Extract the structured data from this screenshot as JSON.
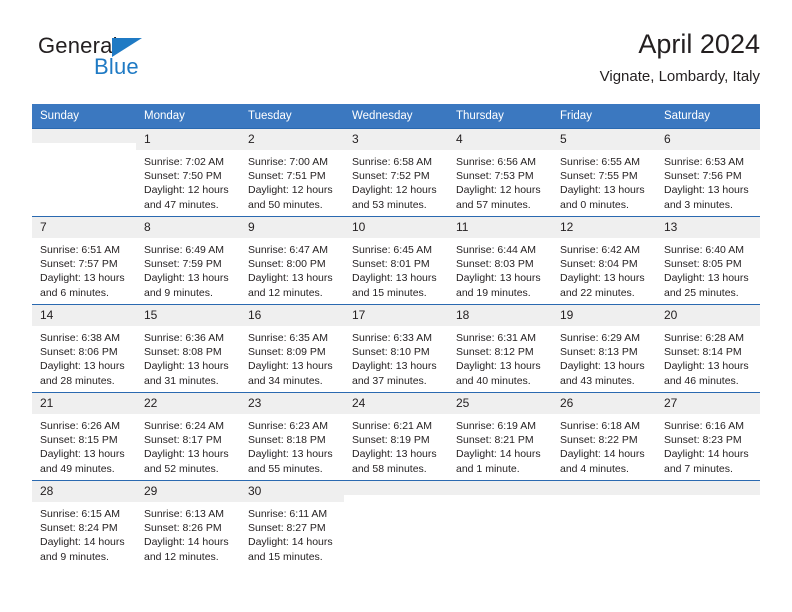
{
  "brand": {
    "name_top": "General",
    "name_bottom": "Blue",
    "triangle_color": "#1f7ac4"
  },
  "header": {
    "title": "April 2024",
    "subtitle": "Vignate, Lombardy, Italy"
  },
  "theme": {
    "header_bg": "#3b78c0",
    "row_border": "#2a69b0",
    "daynum_bg": "#efefef",
    "text": "#231f20"
  },
  "weekdays": [
    "Sunday",
    "Monday",
    "Tuesday",
    "Wednesday",
    "Thursday",
    "Friday",
    "Saturday"
  ],
  "labels": {
    "sunrise_prefix": "Sunrise:",
    "sunset_prefix": "Sunset:",
    "daylight_prefix": "Daylight:"
  },
  "weeks": [
    [
      {
        "day": "",
        "sunrise": "",
        "sunset": "",
        "daylight1": "",
        "daylight2": ""
      },
      {
        "day": "1",
        "sunrise": "Sunrise: 7:02 AM",
        "sunset": "Sunset: 7:50 PM",
        "daylight1": "Daylight: 12 hours",
        "daylight2": "and 47 minutes."
      },
      {
        "day": "2",
        "sunrise": "Sunrise: 7:00 AM",
        "sunset": "Sunset: 7:51 PM",
        "daylight1": "Daylight: 12 hours",
        "daylight2": "and 50 minutes."
      },
      {
        "day": "3",
        "sunrise": "Sunrise: 6:58 AM",
        "sunset": "Sunset: 7:52 PM",
        "daylight1": "Daylight: 12 hours",
        "daylight2": "and 53 minutes."
      },
      {
        "day": "4",
        "sunrise": "Sunrise: 6:56 AM",
        "sunset": "Sunset: 7:53 PM",
        "daylight1": "Daylight: 12 hours",
        "daylight2": "and 57 minutes."
      },
      {
        "day": "5",
        "sunrise": "Sunrise: 6:55 AM",
        "sunset": "Sunset: 7:55 PM",
        "daylight1": "Daylight: 13 hours",
        "daylight2": "and 0 minutes."
      },
      {
        "day": "6",
        "sunrise": "Sunrise: 6:53 AM",
        "sunset": "Sunset: 7:56 PM",
        "daylight1": "Daylight: 13 hours",
        "daylight2": "and 3 minutes."
      }
    ],
    [
      {
        "day": "7",
        "sunrise": "Sunrise: 6:51 AM",
        "sunset": "Sunset: 7:57 PM",
        "daylight1": "Daylight: 13 hours",
        "daylight2": "and 6 minutes."
      },
      {
        "day": "8",
        "sunrise": "Sunrise: 6:49 AM",
        "sunset": "Sunset: 7:59 PM",
        "daylight1": "Daylight: 13 hours",
        "daylight2": "and 9 minutes."
      },
      {
        "day": "9",
        "sunrise": "Sunrise: 6:47 AM",
        "sunset": "Sunset: 8:00 PM",
        "daylight1": "Daylight: 13 hours",
        "daylight2": "and 12 minutes."
      },
      {
        "day": "10",
        "sunrise": "Sunrise: 6:45 AM",
        "sunset": "Sunset: 8:01 PM",
        "daylight1": "Daylight: 13 hours",
        "daylight2": "and 15 minutes."
      },
      {
        "day": "11",
        "sunrise": "Sunrise: 6:44 AM",
        "sunset": "Sunset: 8:03 PM",
        "daylight1": "Daylight: 13 hours",
        "daylight2": "and 19 minutes."
      },
      {
        "day": "12",
        "sunrise": "Sunrise: 6:42 AM",
        "sunset": "Sunset: 8:04 PM",
        "daylight1": "Daylight: 13 hours",
        "daylight2": "and 22 minutes."
      },
      {
        "day": "13",
        "sunrise": "Sunrise: 6:40 AM",
        "sunset": "Sunset: 8:05 PM",
        "daylight1": "Daylight: 13 hours",
        "daylight2": "and 25 minutes."
      }
    ],
    [
      {
        "day": "14",
        "sunrise": "Sunrise: 6:38 AM",
        "sunset": "Sunset: 8:06 PM",
        "daylight1": "Daylight: 13 hours",
        "daylight2": "and 28 minutes."
      },
      {
        "day": "15",
        "sunrise": "Sunrise: 6:36 AM",
        "sunset": "Sunset: 8:08 PM",
        "daylight1": "Daylight: 13 hours",
        "daylight2": "and 31 minutes."
      },
      {
        "day": "16",
        "sunrise": "Sunrise: 6:35 AM",
        "sunset": "Sunset: 8:09 PM",
        "daylight1": "Daylight: 13 hours",
        "daylight2": "and 34 minutes."
      },
      {
        "day": "17",
        "sunrise": "Sunrise: 6:33 AM",
        "sunset": "Sunset: 8:10 PM",
        "daylight1": "Daylight: 13 hours",
        "daylight2": "and 37 minutes."
      },
      {
        "day": "18",
        "sunrise": "Sunrise: 6:31 AM",
        "sunset": "Sunset: 8:12 PM",
        "daylight1": "Daylight: 13 hours",
        "daylight2": "and 40 minutes."
      },
      {
        "day": "19",
        "sunrise": "Sunrise: 6:29 AM",
        "sunset": "Sunset: 8:13 PM",
        "daylight1": "Daylight: 13 hours",
        "daylight2": "and 43 minutes."
      },
      {
        "day": "20",
        "sunrise": "Sunrise: 6:28 AM",
        "sunset": "Sunset: 8:14 PM",
        "daylight1": "Daylight: 13 hours",
        "daylight2": "and 46 minutes."
      }
    ],
    [
      {
        "day": "21",
        "sunrise": "Sunrise: 6:26 AM",
        "sunset": "Sunset: 8:15 PM",
        "daylight1": "Daylight: 13 hours",
        "daylight2": "and 49 minutes."
      },
      {
        "day": "22",
        "sunrise": "Sunrise: 6:24 AM",
        "sunset": "Sunset: 8:17 PM",
        "daylight1": "Daylight: 13 hours",
        "daylight2": "and 52 minutes."
      },
      {
        "day": "23",
        "sunrise": "Sunrise: 6:23 AM",
        "sunset": "Sunset: 8:18 PM",
        "daylight1": "Daylight: 13 hours",
        "daylight2": "and 55 minutes."
      },
      {
        "day": "24",
        "sunrise": "Sunrise: 6:21 AM",
        "sunset": "Sunset: 8:19 PM",
        "daylight1": "Daylight: 13 hours",
        "daylight2": "and 58 minutes."
      },
      {
        "day": "25",
        "sunrise": "Sunrise: 6:19 AM",
        "sunset": "Sunset: 8:21 PM",
        "daylight1": "Daylight: 14 hours",
        "daylight2": "and 1 minute."
      },
      {
        "day": "26",
        "sunrise": "Sunrise: 6:18 AM",
        "sunset": "Sunset: 8:22 PM",
        "daylight1": "Daylight: 14 hours",
        "daylight2": "and 4 minutes."
      },
      {
        "day": "27",
        "sunrise": "Sunrise: 6:16 AM",
        "sunset": "Sunset: 8:23 PM",
        "daylight1": "Daylight: 14 hours",
        "daylight2": "and 7 minutes."
      }
    ],
    [
      {
        "day": "28",
        "sunrise": "Sunrise: 6:15 AM",
        "sunset": "Sunset: 8:24 PM",
        "daylight1": "Daylight: 14 hours",
        "daylight2": "and 9 minutes."
      },
      {
        "day": "29",
        "sunrise": "Sunrise: 6:13 AM",
        "sunset": "Sunset: 8:26 PM",
        "daylight1": "Daylight: 14 hours",
        "daylight2": "and 12 minutes."
      },
      {
        "day": "30",
        "sunrise": "Sunrise: 6:11 AM",
        "sunset": "Sunset: 8:27 PM",
        "daylight1": "Daylight: 14 hours",
        "daylight2": "and 15 minutes."
      },
      {
        "day": "",
        "sunrise": "",
        "sunset": "",
        "daylight1": "",
        "daylight2": ""
      },
      {
        "day": "",
        "sunrise": "",
        "sunset": "",
        "daylight1": "",
        "daylight2": ""
      },
      {
        "day": "",
        "sunrise": "",
        "sunset": "",
        "daylight1": "",
        "daylight2": ""
      },
      {
        "day": "",
        "sunrise": "",
        "sunset": "",
        "daylight1": "",
        "daylight2": ""
      }
    ]
  ]
}
